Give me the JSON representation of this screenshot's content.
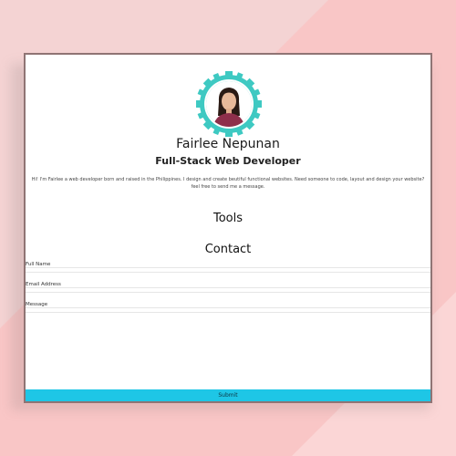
{
  "profile": {
    "name": "Fairlee Nepunan",
    "role": "Full-Stack Web Developer",
    "bio": "Hi! I'm Fairlee a web developer born and raised in the Philippines. I design and create beutiful functional websites. Need someone to code, layout and design your website? feel free to send me a message."
  },
  "sections": {
    "tools": "Tools",
    "contact": "Contact"
  },
  "form": {
    "full_name_label": "Full Name",
    "email_label": "Email Address",
    "message_label": "Message",
    "submit_label": "Submit"
  },
  "colors": {
    "accent": "#1ec6e6",
    "avatar_ring": "#3ec9c2",
    "background": "#f9c6c6"
  },
  "icons": {
    "avatar_frame": "gear-avatar-frame-icon"
  }
}
